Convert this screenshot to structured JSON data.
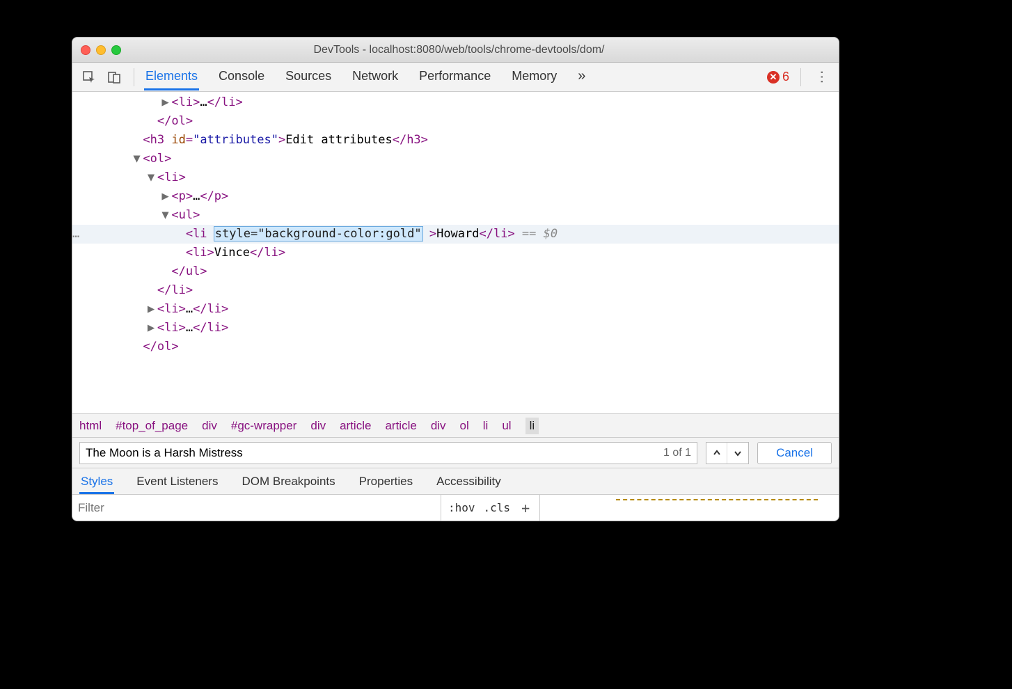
{
  "window": {
    "title": "DevTools - localhost:8080/web/tools/chrome-devtools/dom/"
  },
  "toolbar": {
    "tabs": [
      "Elements",
      "Console",
      "Sources",
      "Network",
      "Performance",
      "Memory"
    ],
    "active_tab": "Elements",
    "overflow_glyph": "»",
    "error_count": "6"
  },
  "dom_tree": {
    "lines": [
      {
        "indent": 11,
        "tri": "▶",
        "open": "<li>",
        "text": "…",
        "close": "</li>",
        "cut": true
      },
      {
        "indent": 10,
        "close": "</ol>"
      },
      {
        "indent": 9,
        "h3_open": "<h3 ",
        "attr_name": "id",
        "attr_val": "\"attributes\"",
        "h3_mid": ">",
        "text": "Edit attributes",
        "h3_close": "</h3>"
      },
      {
        "indent": 9,
        "tri": "▼",
        "open": "<ol>"
      },
      {
        "indent": 10,
        "tri": "▼",
        "open": "<li>"
      },
      {
        "indent": 11,
        "tri": "▶",
        "open": "<p>",
        "text": "…",
        "close": "</p>"
      },
      {
        "indent": 11,
        "tri": "▼",
        "open": "<ul>"
      },
      {
        "indent": 12,
        "selected": true,
        "gutter": "…",
        "li_open": "<li ",
        "edit_attr": "style=\"background-color:gold\"",
        "li_mid": ">",
        "text": "Howard",
        "li_close": "</li>",
        "trailer": " == $0"
      },
      {
        "indent": 12,
        "open": "<li>",
        "text": "Vince",
        "close": "</li>"
      },
      {
        "indent": 11,
        "close": "</ul>"
      },
      {
        "indent": 10,
        "close": "</li>"
      },
      {
        "indent": 10,
        "tri": "▶",
        "open": "<li>",
        "text": "…",
        "close": "</li>"
      },
      {
        "indent": 10,
        "tri": "▶",
        "open": "<li>",
        "text": "…",
        "close": "</li>"
      },
      {
        "indent": 9,
        "close": "</ol>"
      }
    ]
  },
  "breadcrumbs": [
    "html",
    "#top_of_page",
    "div",
    "#gc-wrapper",
    "div",
    "article",
    "article",
    "div",
    "ol",
    "li",
    "ul",
    "li"
  ],
  "breadcrumb_selected_index": 11,
  "search": {
    "value": "The Moon is a Harsh Mistress",
    "count": "1 of 1",
    "cancel": "Cancel"
  },
  "subpanel": {
    "tabs": [
      "Styles",
      "Event Listeners",
      "DOM Breakpoints",
      "Properties",
      "Accessibility"
    ],
    "active": "Styles"
  },
  "filter": {
    "placeholder": "Filter",
    "hov": ":hov",
    "cls": ".cls"
  }
}
